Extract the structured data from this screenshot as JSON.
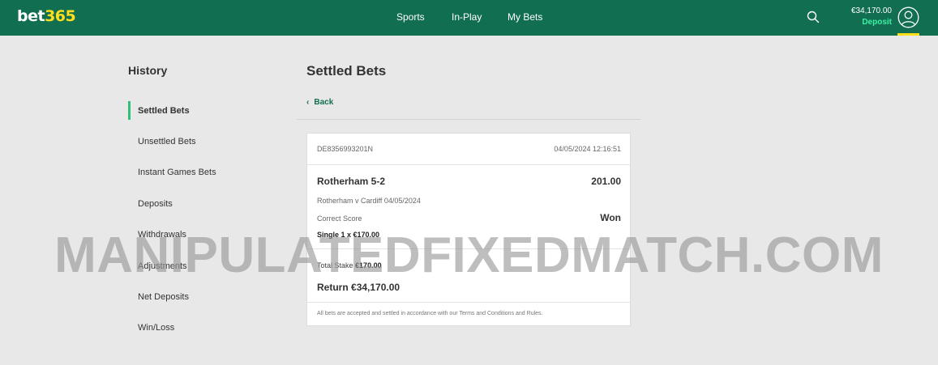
{
  "header": {
    "logo": {
      "part1": "bet",
      "part2": "365"
    },
    "nav": [
      "Sports",
      "In-Play",
      "My Bets"
    ],
    "balance": "€34,170.00",
    "deposit_label": "Deposit",
    "icons": {
      "search": "search-icon",
      "user": "user-icon"
    },
    "colors": {
      "bar": "#126e51",
      "accent_yellow": "#ffdf1b",
      "deposit_green": "#3cf2a5"
    }
  },
  "sidebar": {
    "title": "History",
    "items": [
      {
        "label": "Settled Bets",
        "active": true
      },
      {
        "label": "Unsettled Bets"
      },
      {
        "label": "Instant Games Bets"
      },
      {
        "label": "Deposits"
      },
      {
        "label": "Withdrawals"
      },
      {
        "label": "Adjustments"
      },
      {
        "label": "Net Deposits"
      },
      {
        "label": "Win/Loss"
      }
    ]
  },
  "main": {
    "title": "Settled Bets",
    "back_label": "Back",
    "bet": {
      "ref": "DE8356993201N",
      "datetime": "04/05/2024 12:16:51",
      "selection": "Rotherham 5-2",
      "odds": "201.00",
      "event": "Rotherham v Cardiff 04/05/2024",
      "market": "Correct Score",
      "result": "Won",
      "bet_type": "Single 1 x €170.00",
      "stake_label": "Total Stake",
      "stake_value": "€170.00",
      "return_label": "Return",
      "return_value": "€34,170.00",
      "terms": "All bets are accepted and settled in accordance with our Terms and Conditions and Rules."
    }
  },
  "watermark": "MANIPULATEDFIXEDMATCH.COM"
}
